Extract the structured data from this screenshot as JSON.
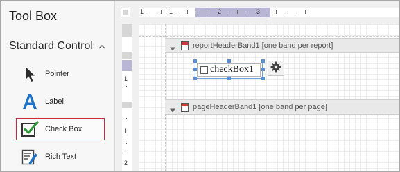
{
  "toolbox": {
    "title": "Tool Box",
    "group": {
      "label": "Standard Controls",
      "icon": "chevron-up-icon"
    },
    "items": [
      {
        "label": "Pointer",
        "icon": "pointer-icon"
      },
      {
        "label": "Label",
        "icon": "label-icon"
      },
      {
        "label": "Check Box",
        "icon": "checkbox-icon",
        "selected": true
      },
      {
        "label": "Rich Text",
        "icon": "rich-text-icon"
      }
    ]
  },
  "ruler": {
    "horizontal_numbers": [
      "1",
      "1",
      "2",
      "3"
    ],
    "vertical_numbers": [
      "1",
      "1",
      "2"
    ]
  },
  "bands": [
    {
      "name": "reportHeaderBand1 [one band per report]"
    },
    {
      "name": "pageHeaderBand1 [one band per page]"
    }
  ],
  "control": {
    "text": "checkBox1",
    "smart_tag_icon": "gear-icon"
  },
  "colors": {
    "selection_border": "#c8283a",
    "ruler_highlight": "#b9b5d4",
    "control_border": "#6f9fd8",
    "label_icon_blue": "#1e73c8",
    "checkmark_green": "#2e9b3a"
  }
}
